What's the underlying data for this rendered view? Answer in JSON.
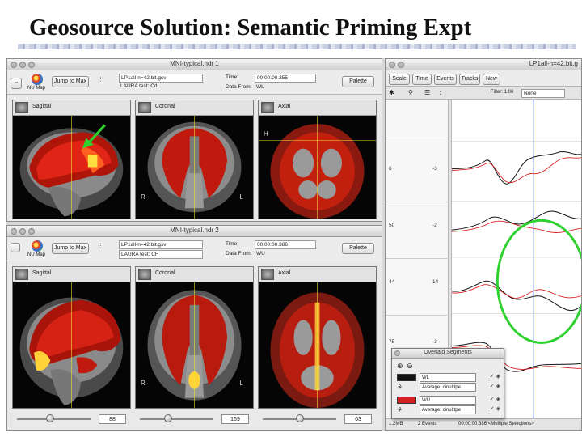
{
  "slide": {
    "title": "Geosource Solution: Semantic Priming Expt"
  },
  "viewer1": {
    "window_title": "MNI-typical.hdr 1",
    "jump_button": "Jump to Max",
    "nu_map_label": "NU Map",
    "file_name": "LP1all-n=42.bit.gsv",
    "laura_label": "LAURA test: Cd",
    "time_label": "Time:",
    "time_value": "00:00:00.355",
    "data_from_label": "Data From:",
    "data_from_value": "WL",
    "palette_button": "Palette",
    "panes": {
      "sagittal": "Sagittal",
      "coronal": "Coronal",
      "axial": "Axial"
    },
    "orient": {
      "r": "R",
      "l": "L",
      "h": "H"
    }
  },
  "viewer2": {
    "window_title": "MNI-typical.hdr 2",
    "jump_button": "Jump to Max",
    "nu_map_label": "NU Map",
    "file_name": "LP1all-n=42.bit.gsv",
    "laura_label": "LAURA test: CF",
    "time_label": "Time:",
    "time_value": "00:00:00.386",
    "data_from_label": "Data From:",
    "data_from_value": "WU",
    "palette_button": "Palette",
    "panes": {
      "sagittal": "Sagittal",
      "coronal": "Coronal",
      "axial": "Axial"
    },
    "orient": {
      "r": "R",
      "l": "L"
    },
    "slider_values": [
      "88",
      "169",
      "63"
    ],
    "slider_levels": [
      0.45,
      0.38,
      0.5
    ]
  },
  "erp": {
    "window_title": "LP1all-n=42.bit.g",
    "toolbar": {
      "scale": "Scale",
      "time": "Time",
      "events": "Events",
      "tracks": "Tracks",
      "new": "New"
    },
    "filter_label": "Filter: 1.00",
    "filter_value": "None",
    "channels": [
      {
        "label": "6",
        "value": "-3"
      },
      {
        "label": "50",
        "value": "-2"
      },
      {
        "label": "44",
        "value": "14"
      },
      {
        "label": "75",
        "value": "-3"
      }
    ],
    "status_text": "2 Events",
    "status_time": "00:00:00.386 <Multiple Selections>",
    "status_left": "1.2MB"
  },
  "overlay": {
    "title": "Overlaid Segments",
    "rows": [
      {
        "color": "#111111",
        "name": "WL",
        "type": "Average: cinulttpe"
      },
      {
        "color": "#d42020",
        "name": "WU",
        "type": "Average: cinulttpe"
      }
    ]
  },
  "colors": {
    "highlight_circle": "#2fd12f",
    "arrow": "#2fd12f",
    "activation": "#d81e10",
    "cursor_line": "#2838a8"
  }
}
